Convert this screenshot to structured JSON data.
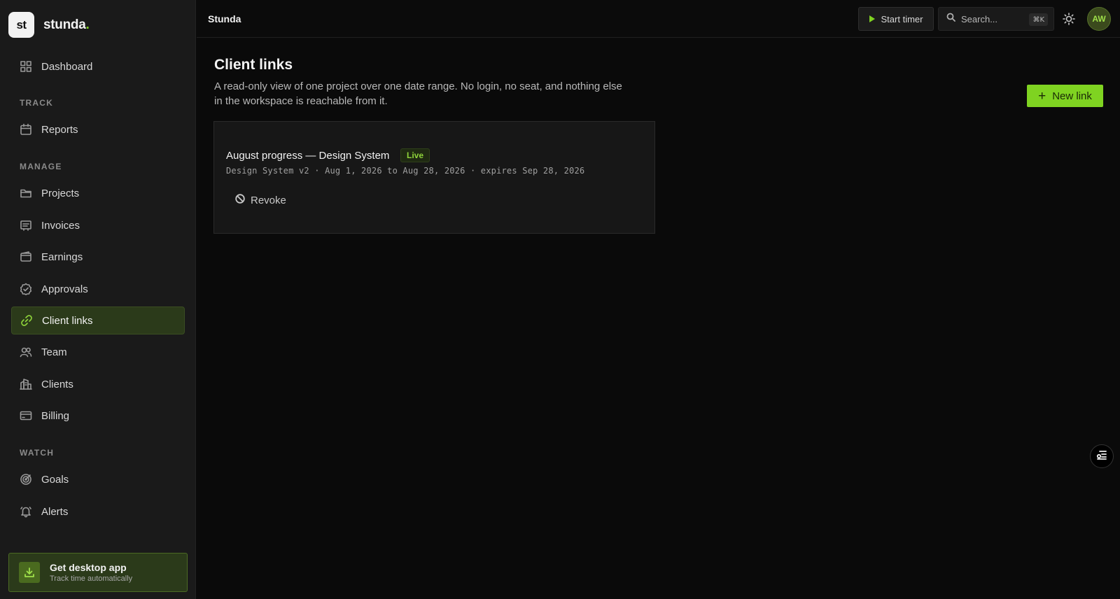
{
  "brand": {
    "logo_mark": "st",
    "name": "stunda",
    "name_dot": "."
  },
  "sidebar": {
    "dashboard": {
      "label": "Dashboard",
      "icon": "grid-icon"
    },
    "sections": {
      "track": "TRACK",
      "manage": "MANAGE",
      "watch": "WATCH"
    },
    "items": [
      {
        "label": "Reports",
        "icon": "calendar-icon"
      },
      {
        "label": "Projects",
        "icon": "folder-icon"
      },
      {
        "label": "Invoices",
        "icon": "invoice-icon"
      },
      {
        "label": "Earnings",
        "icon": "wallet-icon"
      },
      {
        "label": "Approvals",
        "icon": "badge-check-icon"
      },
      {
        "label": "Client links",
        "icon": "link-icon",
        "active": true
      },
      {
        "label": "Team",
        "icon": "users-icon"
      },
      {
        "label": "Clients",
        "icon": "building-icon"
      },
      {
        "label": "Billing",
        "icon": "card-icon"
      },
      {
        "label": "Goals",
        "icon": "target-icon"
      },
      {
        "label": "Alerts",
        "icon": "bell-icon"
      }
    ],
    "desktop_app": {
      "title": "Get desktop app",
      "subtitle": "Track time automatically",
      "icon": "download-icon"
    }
  },
  "topbar": {
    "app_name": "Stunda",
    "start_timer": "Start timer",
    "search_placeholder": "Search...",
    "search_shortcut": "⌘K",
    "theme_icon": "sun-icon",
    "avatar_initials": "AW"
  },
  "main": {
    "title": "Client links",
    "description": "A read-only view of one project over one date range. No login, no seat, and nothing else in the workspace is reachable from it.",
    "new_link_label": "New link",
    "links": [
      {
        "title": "August progress — Design System",
        "status": "Live",
        "meta": "Design System v2 · Aug 1, 2026 to Aug 28, 2026 · expires Sep 28, 2026",
        "revoke_label": "Revoke"
      }
    ]
  },
  "colors": {
    "accent": "#7fd321",
    "sidebar_bg": "#1a1a1a",
    "page_bg": "#0a0a0a",
    "active_bg": "#2b3a1a"
  }
}
